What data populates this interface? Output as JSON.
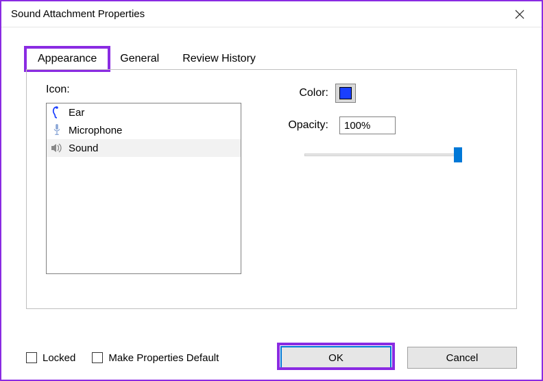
{
  "window": {
    "title": "Sound Attachment Properties"
  },
  "tabs": [
    {
      "label": "Appearance",
      "active": true
    },
    {
      "label": "General",
      "active": false
    },
    {
      "label": "Review History",
      "active": false
    }
  ],
  "appearance": {
    "icon_label": "Icon:",
    "icons": [
      {
        "kind": "ear",
        "label": "Ear",
        "selected": false
      },
      {
        "kind": "microphone",
        "label": "Microphone",
        "selected": false
      },
      {
        "kind": "sound",
        "label": "Sound",
        "selected": true
      }
    ],
    "color_label": "Color:",
    "color_value": "#1a3fff",
    "opacity_label": "Opacity:",
    "opacity_value": "100%",
    "opacity_slider": 100
  },
  "footer": {
    "locked_label": "Locked",
    "locked_checked": false,
    "make_default_label": "Make Properties Default",
    "make_default_checked": false,
    "ok_label": "OK",
    "cancel_label": "Cancel"
  },
  "highlights": {
    "tab_appearance": true,
    "ok_button": true
  }
}
